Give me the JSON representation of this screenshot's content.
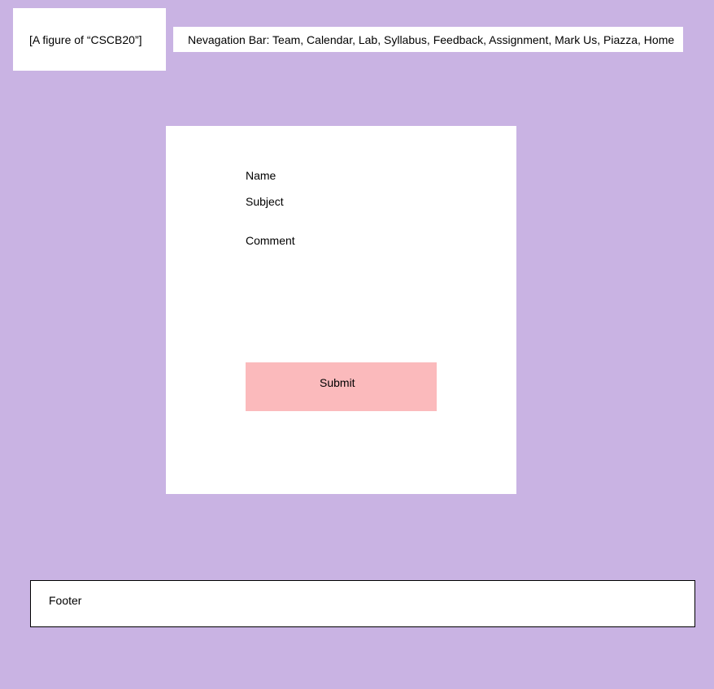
{
  "header": {
    "logo_text": "[A figure of “CSCB20”]",
    "nav_text": "Nevagation Bar: Team, Calendar, Lab, Syllabus, Feedback, Assignment, Mark Us, Piazza, Home"
  },
  "form": {
    "name_label": "Name",
    "subject_label": "Subject",
    "comment_label": "Comment",
    "submit_label": "Submit"
  },
  "footer": {
    "text": "Footer"
  },
  "colors": {
    "background": "#c9b3e3",
    "panel": "#ffffff",
    "submit_button": "#fbbabc"
  }
}
